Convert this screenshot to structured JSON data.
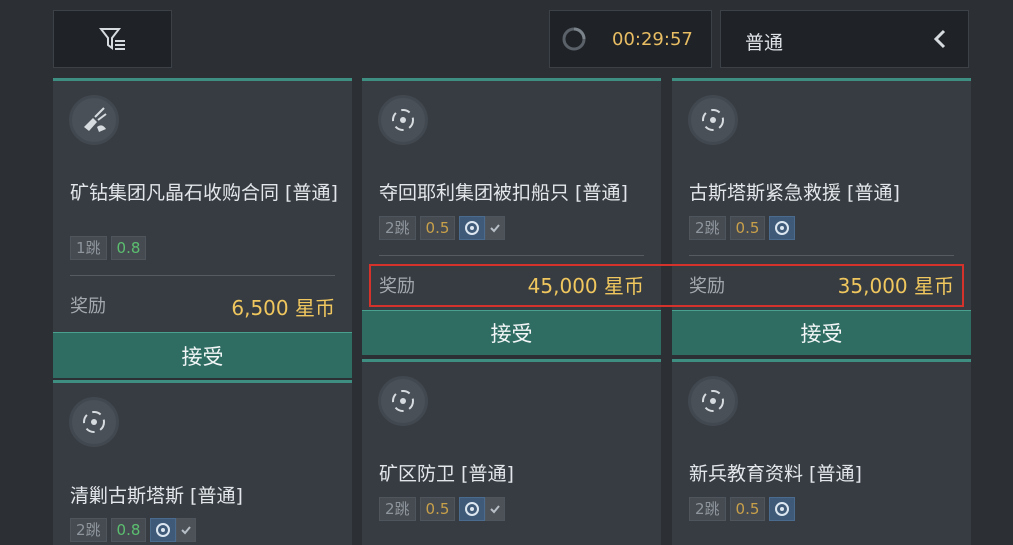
{
  "toolbar": {
    "filter_icon": "filter-icon",
    "timer": "00:29:57",
    "timer_icon": "refresh-icon",
    "level": "普通",
    "collapse_icon": "chevron-left-icon"
  },
  "missions": [
    {
      "title": "矿钻集团凡晶石收购合同 [普通]",
      "icon": "mining-laser-icon",
      "jumps": "1跳",
      "security": "0.8",
      "reward_label": "奖励",
      "reward": "6,500 星币",
      "accept": "接受"
    },
    {
      "title": "夺回耶利集团被扣船只 [普通]",
      "icon": "target-crosshair-icon",
      "jumps": "2跳",
      "security": "0.5",
      "reward_label": "奖励",
      "reward": "45,000 星币",
      "accept": "接受"
    },
    {
      "title": "古斯塔斯紧急救援 [普通]",
      "icon": "target-crosshair-icon",
      "jumps": "2跳",
      "security": "0.5",
      "reward_label": "奖励",
      "reward": "35,000 星币",
      "accept": "接受"
    },
    {
      "title": "清剿古斯塔斯 [普通]",
      "icon": "target-crosshair-icon",
      "jumps": "2跳",
      "security": "0.8"
    },
    {
      "title": "矿区防卫 [普通]",
      "icon": "target-crosshair-icon",
      "jumps": "2跳",
      "security": "0.5"
    },
    {
      "title": "新兵教育资料 [普通]",
      "icon": "target-crosshair-icon",
      "jumps": "2跳",
      "security": "0.5"
    }
  ],
  "colors": {
    "accent_teal": "#3e8f82",
    "reward_gold": "#f0c75e",
    "highlight_red": "#d6322c"
  }
}
